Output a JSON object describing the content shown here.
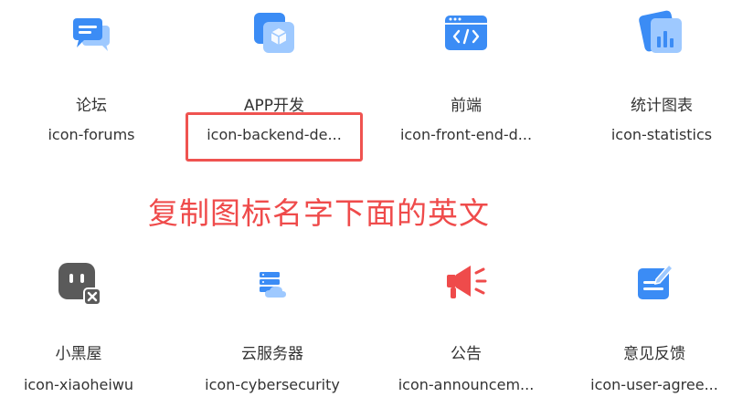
{
  "colors": {
    "brand_blue": "#3b8cf5",
    "light_blue": "#9ec9ff",
    "dark_gray": "#5a5a5a",
    "red": "#ef4b4b"
  },
  "icons": [
    {
      "cn": "论坛",
      "en": "icon-forums",
      "icon": "forums-icon"
    },
    {
      "cn": "APP开发",
      "en": "icon-backend-de...",
      "icon": "backend-development-icon"
    },
    {
      "cn": "前端",
      "en": "icon-front-end-d...",
      "icon": "front-end-code-icon"
    },
    {
      "cn": "统计图表",
      "en": "icon-statistics",
      "icon": "statistics-chart-icon"
    },
    {
      "cn": "小黑屋",
      "en": "icon-xiaoheiwu",
      "icon": "blocked-user-icon"
    },
    {
      "cn": "云服务器",
      "en": "icon-cybersecurity",
      "icon": "cloud-server-icon"
    },
    {
      "cn": "公告",
      "en": "icon-announcem...",
      "icon": "announcement-megaphone-icon"
    },
    {
      "cn": "意见反馈",
      "en": "icon-user-agree...",
      "icon": "feedback-edit-icon"
    }
  ],
  "annotation": {
    "text": "复制图标名字下面的英文"
  }
}
